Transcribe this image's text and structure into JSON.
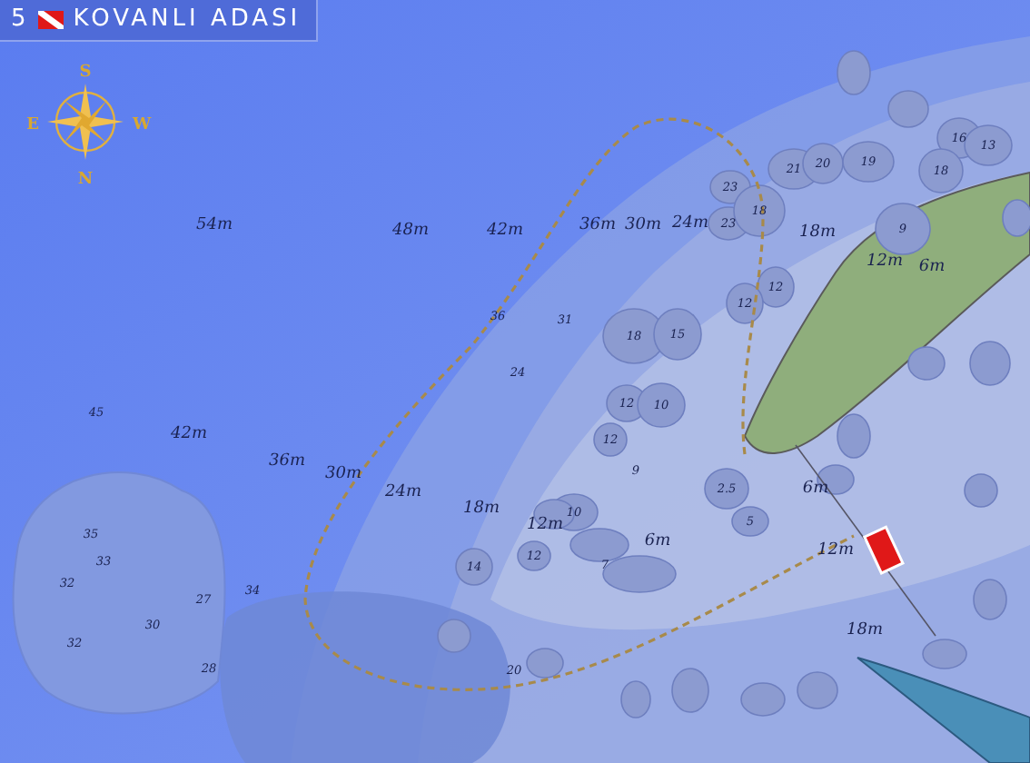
{
  "title": {
    "number": "5",
    "name": "KOVANLI ADASI"
  },
  "compass": {
    "top": "S",
    "left": "E",
    "right": "W",
    "bottom": "N"
  },
  "depth_labels": [
    "54m",
    "48m",
    "42m",
    "36m",
    "30m",
    "24m",
    "18m",
    "12m",
    "6m",
    "42m",
    "36m",
    "30m",
    "24m",
    "18m",
    "12m",
    "6m",
    "6m",
    "12m",
    "18m"
  ],
  "spot_depths": [
    "45",
    "36",
    "24",
    "31",
    "16",
    "13",
    "21",
    "20",
    "19",
    "18",
    "23",
    "23",
    "18",
    "9",
    "12",
    "12",
    "18",
    "15",
    "12",
    "10",
    "12",
    "9",
    "10",
    "2.5",
    "5",
    "14",
    "12",
    "7",
    "20",
    "35",
    "33",
    "32",
    "32",
    "30",
    "27",
    "28",
    "34"
  ]
}
